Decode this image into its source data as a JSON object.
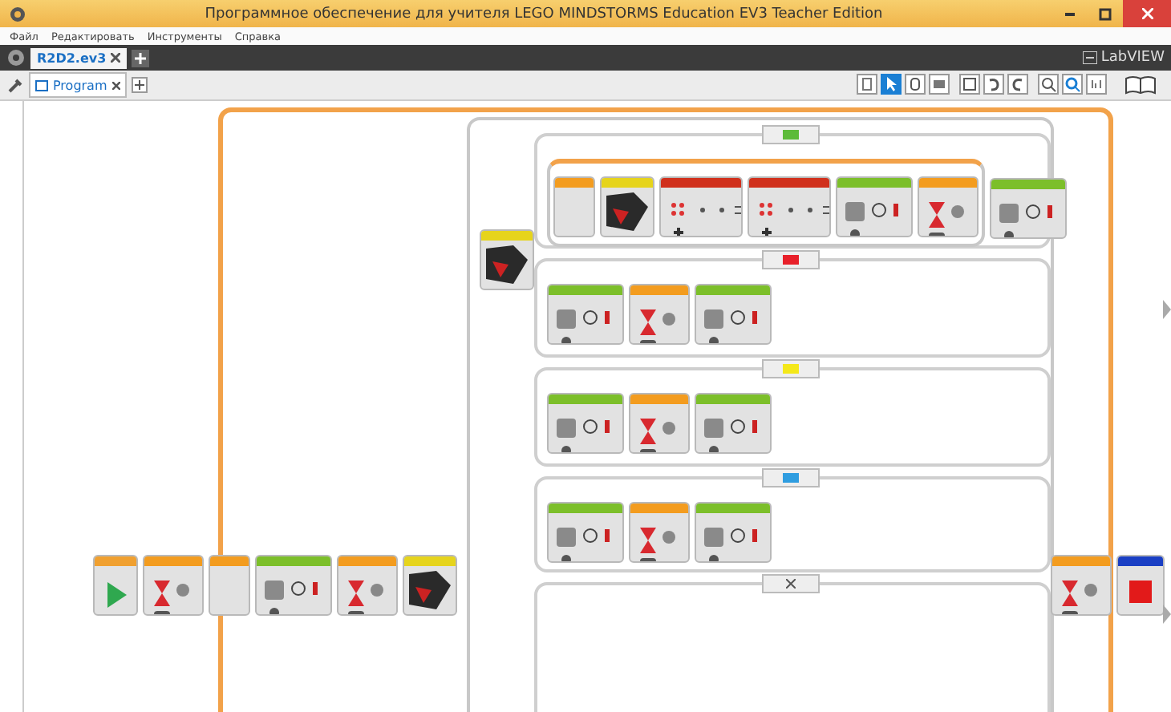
{
  "window": {
    "title": "Программное обеспечение для учителя LEGO MINDSTORMS Education EV3 Teacher Edition"
  },
  "menu": [
    "Файл",
    "Редактировать",
    "Инструменты",
    "Справка"
  ],
  "project_tabs": [
    {
      "label": "R2D2.ev3",
      "selected": true
    }
  ],
  "program_tabs": [
    {
      "label": "Program",
      "selected": true
    }
  ],
  "brand": "LabVIEW",
  "main_row": [
    {
      "kind": "start"
    },
    {
      "kind": "flow"
    },
    {
      "kind": "loop_start"
    },
    {
      "kind": "action"
    },
    {
      "kind": "flow"
    },
    {
      "kind": "sensor"
    }
  ],
  "switch": {
    "block": {
      "kind": "sensor"
    },
    "cases": [
      {
        "kind": "color",
        "color": "#5dbb3a",
        "loop": [
          {
            "kind": "loop_start"
          },
          {
            "kind": "sensor"
          },
          {
            "kind": "data"
          },
          {
            "kind": "data"
          },
          {
            "kind": "action"
          },
          {
            "kind": "flow"
          }
        ],
        "blocks": [
          {
            "kind": "action"
          }
        ]
      },
      {
        "kind": "color",
        "color": "#e8202a",
        "blocks": [
          {
            "kind": "action"
          },
          {
            "kind": "flow"
          },
          {
            "kind": "action"
          }
        ]
      },
      {
        "kind": "color",
        "color": "#f4e81a",
        "blocks": [
          {
            "kind": "action"
          },
          {
            "kind": "flow"
          },
          {
            "kind": "action"
          }
        ]
      },
      {
        "kind": "color",
        "color": "#2f9de0",
        "blocks": [
          {
            "kind": "action"
          },
          {
            "kind": "flow"
          },
          {
            "kind": "action"
          }
        ]
      },
      {
        "kind": "none"
      }
    ]
  },
  "after_switch": [
    {
      "kind": "flow"
    },
    {
      "kind": "stop"
    }
  ]
}
